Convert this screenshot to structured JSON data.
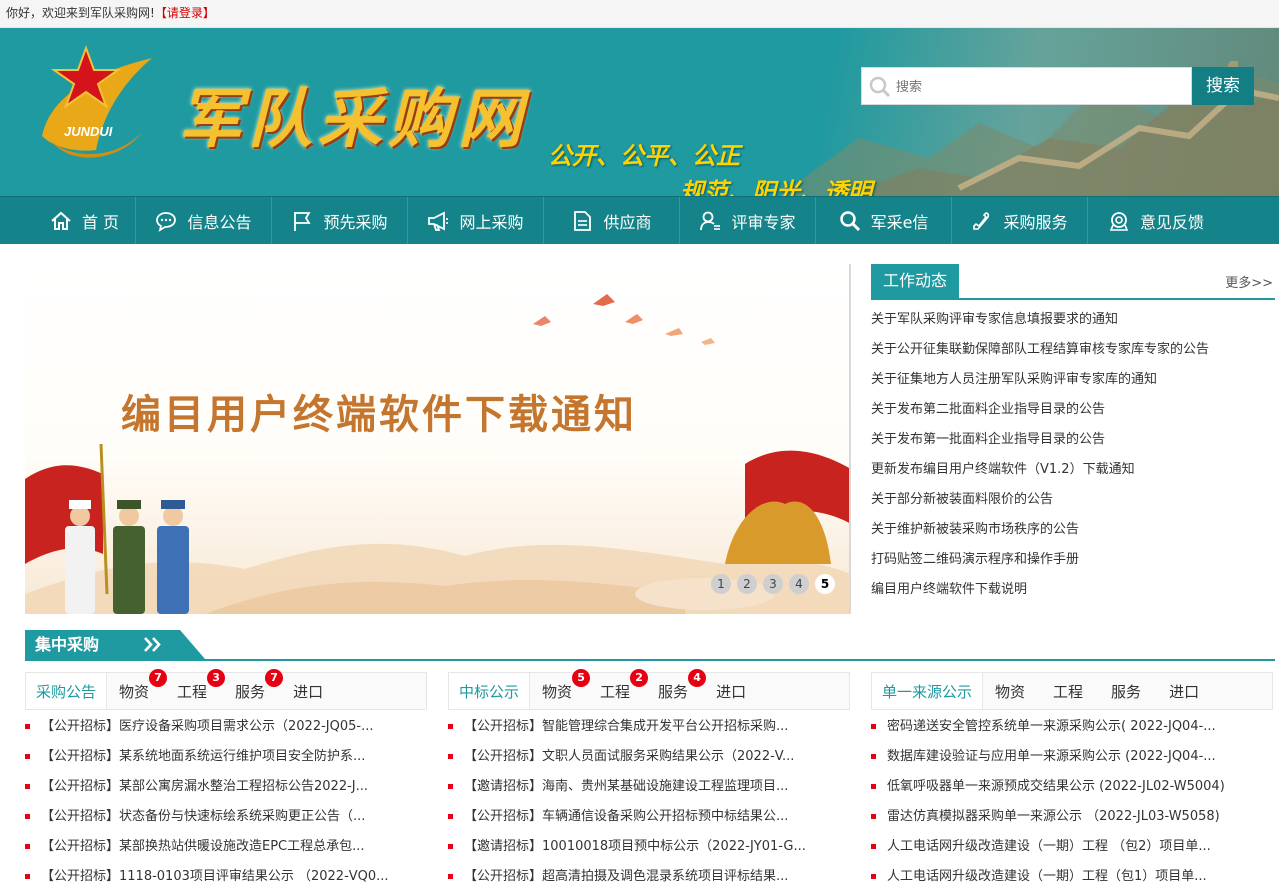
{
  "topbar": {
    "greeting": "你好，欢迎来到军队采购网!",
    "login": "【请登录】"
  },
  "header": {
    "brand": "军队采购网",
    "emblem_text": "JUNDUI",
    "slogan1": "公开、公平、公正",
    "slogan2": "规范、阳光、透明",
    "search_placeholder": "搜索",
    "search_button": "搜索"
  },
  "nav": [
    {
      "label": "首 页",
      "icon": "home-icon"
    },
    {
      "label": "信息公告",
      "icon": "chat-icon"
    },
    {
      "label": "预先采购",
      "icon": "flag-icon"
    },
    {
      "label": "网上采购",
      "icon": "megaphone-icon"
    },
    {
      "label": "供应商",
      "icon": "document-icon"
    },
    {
      "label": "评审专家",
      "icon": "expert-icon"
    },
    {
      "label": "军采e信",
      "icon": "search-icon"
    },
    {
      "label": "采购服务",
      "icon": "phone-icon"
    },
    {
      "label": "意见反馈",
      "icon": "feedback-icon"
    }
  ],
  "banner": {
    "title": "编目用户终端软件下载通知",
    "dots": [
      "1",
      "2",
      "3",
      "4",
      "5"
    ],
    "active_dot": 5
  },
  "news": {
    "title": "工作动态",
    "more": "更多>>",
    "items": [
      "关于军队采购评审专家信息填报要求的通知",
      "关于公开征集联勤保障部队工程结算审核专家库专家的公告",
      "关于征集地方人员注册军队采购评审专家库的通知",
      "关于发布第二批面料企业指导目录的公告",
      "关于发布第一批面料企业指导目录的公告",
      "更新发布编目用户终端软件（V1.2）下载通知",
      "关于部分新被装面料限价的公告",
      "关于维护新被装采购市场秩序的公告",
      "打码贴签二维码演示程序和操作手册",
      "编目用户终端软件下载说明"
    ]
  },
  "section": {
    "title": "集中采购"
  },
  "columns": [
    {
      "tabs": [
        {
          "label": "采购公告",
          "badge": ""
        },
        {
          "label": "物资",
          "badge": "7"
        },
        {
          "label": "工程",
          "badge": "3"
        },
        {
          "label": "服务",
          "badge": "7"
        },
        {
          "label": "进口",
          "badge": ""
        }
      ],
      "items": [
        "【公开招标】医疗设备采购项目需求公示（2022-JQ05-...",
        "【公开招标】某系统地面系统运行维护项目安全防护系...",
        "【公开招标】某部公寓房漏水整治工程招标公告2022-J...",
        "【公开招标】状态备份与快速标绘系统采购更正公告（...",
        "【公开招标】某部换热站供暖设施改造EPC工程总承包...",
        "【公开招标】1118-0103项目评审结果公示 （2022-VQ0..."
      ]
    },
    {
      "tabs": [
        {
          "label": "中标公示",
          "badge": ""
        },
        {
          "label": "物资",
          "badge": "5"
        },
        {
          "label": "工程",
          "badge": "2"
        },
        {
          "label": "服务",
          "badge": "4"
        },
        {
          "label": "进口",
          "badge": ""
        }
      ],
      "items": [
        "【公开招标】智能管理综合集成开发平台公开招标采购...",
        "【公开招标】文职人员面试服务采购结果公示（2022-V...",
        "【邀请招标】海南、贵州某基础设施建设工程监理项目...",
        "【公开招标】车辆通信设备采购公开招标预中标结果公...",
        "【邀请招标】10010018项目预中标公示（2022-JY01-G...",
        "【公开招标】超高清拍摄及调色混录系统项目评标结果..."
      ]
    },
    {
      "tabs": [
        {
          "label": "单一来源公示",
          "badge": ""
        },
        {
          "label": "物资",
          "badge": ""
        },
        {
          "label": "工程",
          "badge": ""
        },
        {
          "label": "服务",
          "badge": ""
        },
        {
          "label": "进口",
          "badge": ""
        }
      ],
      "items": [
        "密码递送安全管控系统单一来源采购公示( 2022-JQ04-...",
        "数据库建设验证与应用单一来源采购公示 (2022-JQ04-...",
        "低氧呼吸器单一来源预成交结果公示 (2022-JL02-W5004)",
        "雷达仿真模拟器采购单一来源公示 （2022-JL03-W5058)",
        "人工电话网升级改造建设（一期）工程 （包2）项目单...",
        "人工电话网升级改造建设（一期）工程（包1）项目单..."
      ]
    }
  ]
}
